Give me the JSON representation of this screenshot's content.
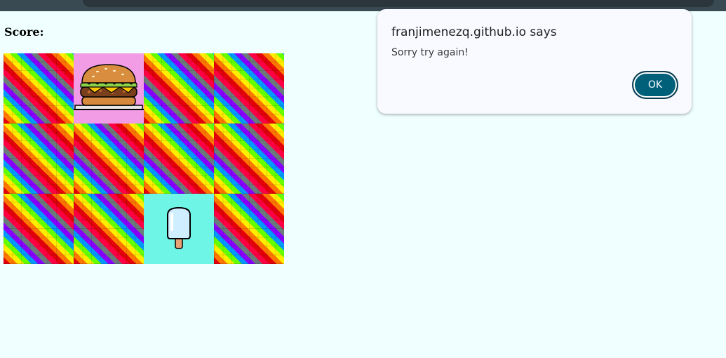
{
  "score": {
    "label": "Score:"
  },
  "board": {
    "tiles": [
      {
        "state": "hidden"
      },
      {
        "state": "revealed",
        "icon": "burger-icon"
      },
      {
        "state": "hidden"
      },
      {
        "state": "hidden"
      },
      {
        "state": "hidden"
      },
      {
        "state": "hidden"
      },
      {
        "state": "hidden"
      },
      {
        "state": "hidden"
      },
      {
        "state": "hidden"
      },
      {
        "state": "hidden"
      },
      {
        "state": "revealed",
        "icon": "popsicle-icon"
      },
      {
        "state": "hidden"
      }
    ]
  },
  "dialog": {
    "title": "franjimenezq.github.io says",
    "message": "Sorry try again!",
    "ok_label": "OK"
  },
  "colors": {
    "page_background": "#f0ffff",
    "burger_tile": "#f29ce6",
    "popsicle_tile": "#6ff5e6",
    "ok_button": "#00607a"
  }
}
